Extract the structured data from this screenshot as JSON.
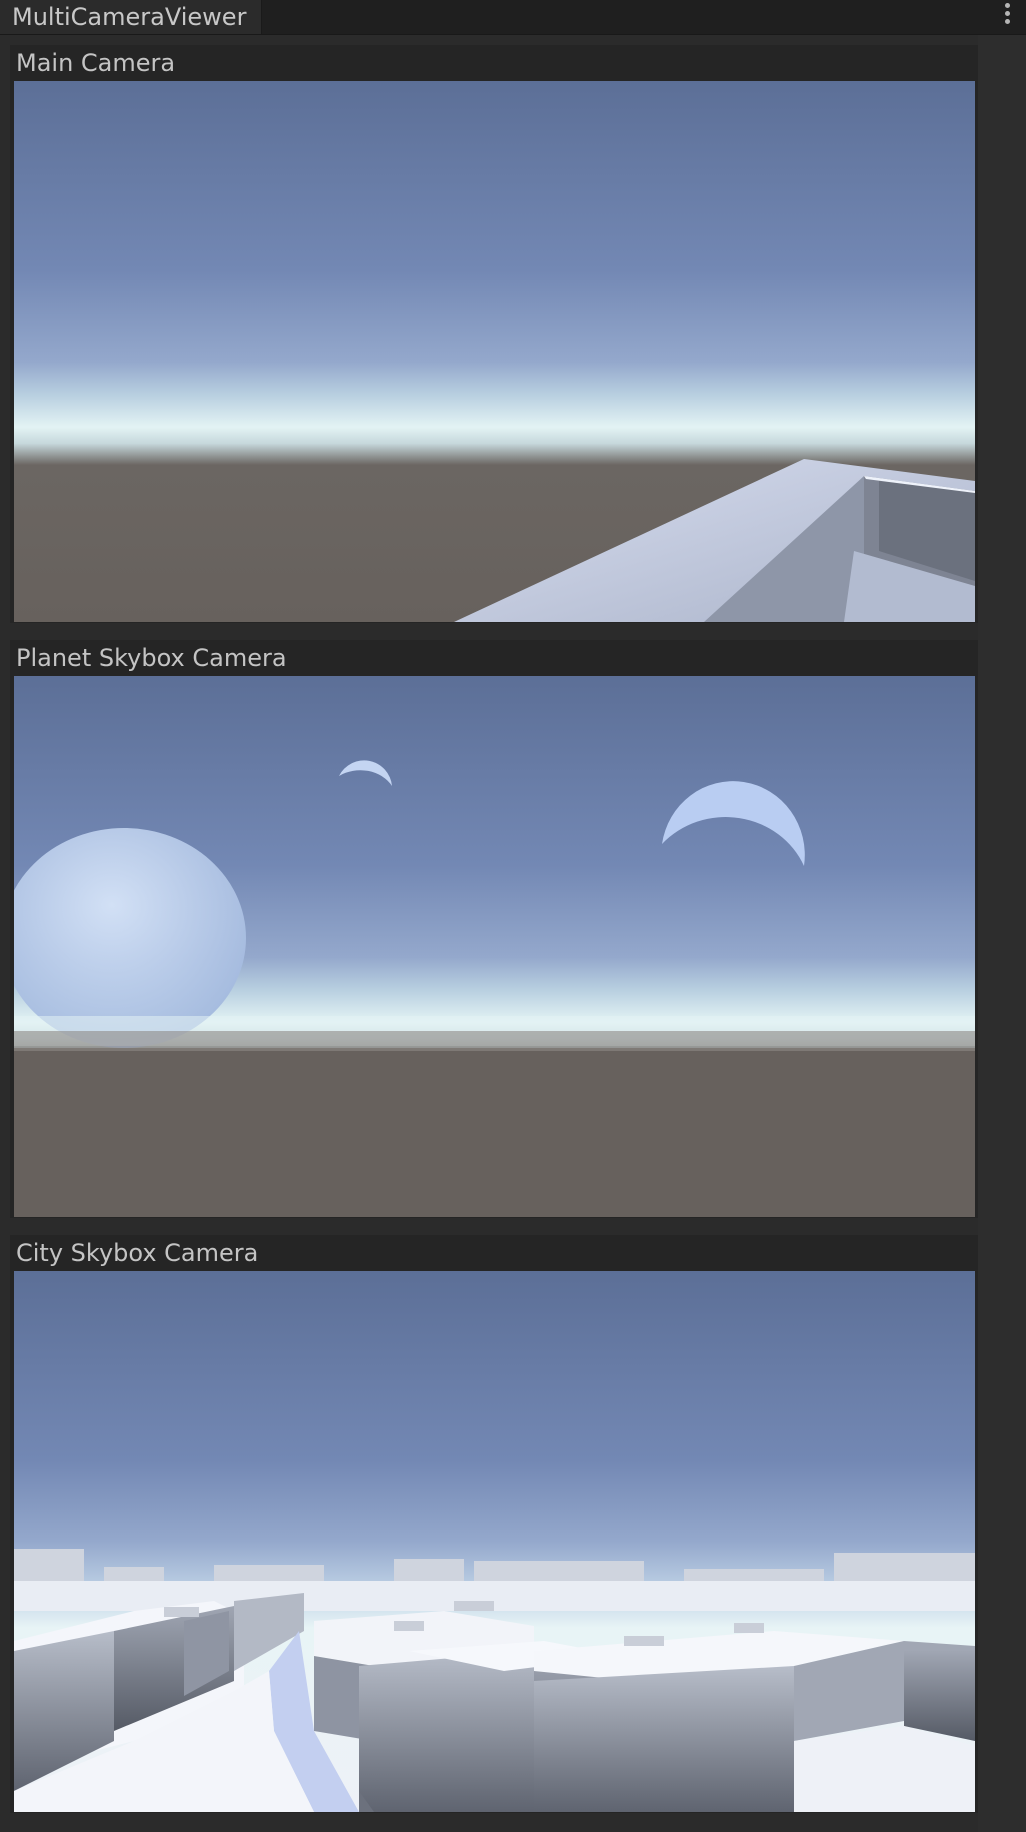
{
  "window": {
    "tab_title": "MultiCameraViewer",
    "menu_icon": "kebab-menu-icon"
  },
  "cameras": [
    {
      "label": "Main Camera",
      "scene": "horizon-with-platform"
    },
    {
      "label": "Planet Skybox Camera",
      "scene": "horizon-with-planets"
    },
    {
      "label": "City Skybox Camera",
      "scene": "city-blocks"
    }
  ],
  "colors": {
    "sky_top": "#5c6f97",
    "sky_mid": "#8196c0",
    "horizon_glow": "#dff0f3",
    "ground": "#67615d",
    "platform": "#c3cbe0",
    "building": "#a8afbd",
    "building_top": "#f2f5fb"
  }
}
